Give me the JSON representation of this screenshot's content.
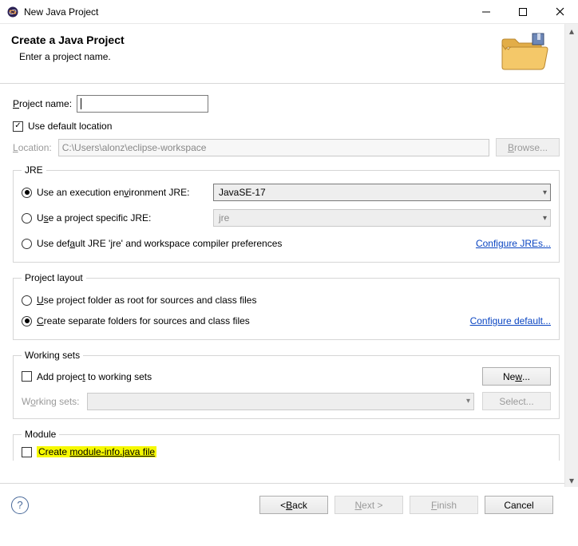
{
  "window": {
    "title": "New Java Project"
  },
  "header": {
    "title": "Create a Java Project",
    "subtitle": "Enter a project name."
  },
  "project_name": {
    "label_pre": "P",
    "label_post": "roject name:",
    "value": ""
  },
  "default_loc": {
    "checked": true,
    "label": "Use default location"
  },
  "location": {
    "label_pre": "L",
    "label_post": "ocation:",
    "value": "C:\\Users\\alonz\\eclipse-workspace",
    "browse_pre": "B",
    "browse_post": "rowse..."
  },
  "jre": {
    "legend": "JRE",
    "exec_env": {
      "selected": true,
      "label_pre": "Use an execution en",
      "label_u": "v",
      "label_post": "ironment JRE:",
      "value": "JavaSE-17"
    },
    "project_specific": {
      "selected": false,
      "label_pre": "U",
      "label_u": "s",
      "label_post": "e a project specific JRE:",
      "value": "jre"
    },
    "default_jre": {
      "selected": false,
      "label_pre": "Use def",
      "label_u": "a",
      "label_post": "ult JRE 'jre' and workspace compiler preferences"
    },
    "configure": "Configure JREs..."
  },
  "layout": {
    "legend": "Project layout",
    "as_root": {
      "selected": false,
      "label_pre": "",
      "label_u": "U",
      "label_post": "se project folder as root for sources and class files"
    },
    "separate": {
      "selected": true,
      "label_pre": "",
      "label_u": "C",
      "label_post": "reate separate folders for sources and class files"
    },
    "configure": "Configure default..."
  },
  "working_sets": {
    "legend": "Working sets",
    "add": {
      "checked": false,
      "label_pre": "Add projec",
      "label_u": "t",
      "label_post": " to working sets"
    },
    "new_pre": "Ne",
    "new_u": "w",
    "new_post": "...",
    "label_pre": "W",
    "label_u": "o",
    "label_post": "rking sets:",
    "select_label": "Select..."
  },
  "module": {
    "legend": "Module",
    "create": {
      "checked": false,
      "label_pre": "Create ",
      "label_u_text": "module-info.java file"
    }
  },
  "footer": {
    "back_pre": "< ",
    "back_u": "B",
    "back_post": "ack",
    "next_pre": "",
    "next_u": "N",
    "next_post": "ext >",
    "finish_pre": "",
    "finish_u": "F",
    "finish_post": "inish",
    "cancel": "Cancel"
  }
}
